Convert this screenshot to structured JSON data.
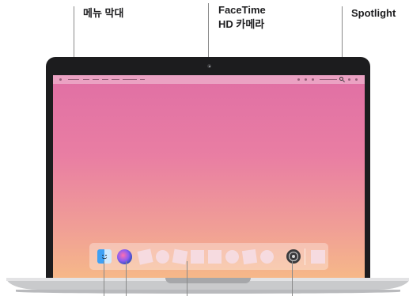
{
  "callouts": {
    "menubar_label": "메뉴 막대",
    "camera_line1": "FaceTime",
    "camera_line2": "HD 카메라",
    "spotlight_label": "Spotlight"
  },
  "dock": {
    "items": [
      "finder-icon",
      "siri-icon",
      "app-icon",
      "app-icon",
      "app-icon",
      "app-icon",
      "app-icon",
      "app-icon",
      "app-icon",
      "app-icon",
      "system-preferences-icon",
      "trash-icon"
    ]
  },
  "colors": {
    "wallpaper_top": "#e06fa4",
    "wallpaper_bottom": "#f6b889",
    "bezel": "#1c1c1e",
    "base": "#c9cacc"
  }
}
